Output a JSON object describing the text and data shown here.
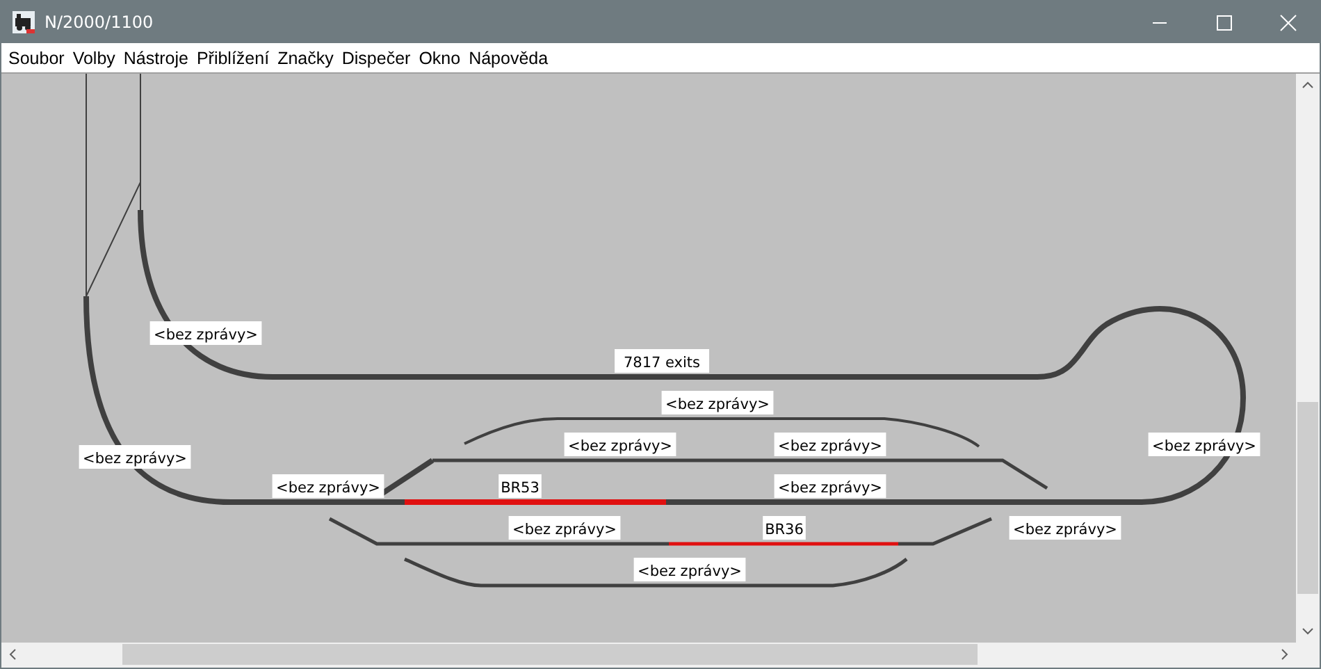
{
  "window": {
    "title": "N/2000/1100"
  },
  "menu": [
    "Soubor",
    "Volby",
    "Nástroje",
    "Přiblížení",
    "Značky",
    "Dispečer",
    "Okno",
    "Nápověda"
  ],
  "blocks": [
    {
      "label": "<bez zprávy>",
      "occupied": false
    },
    {
      "label": "7817 exits",
      "occupied": false
    },
    {
      "label": "<bez zprávy>",
      "occupied": false
    },
    {
      "label": "<bez zprávy>",
      "occupied": false
    },
    {
      "label": "<bez zprávy>",
      "occupied": false
    },
    {
      "label": "<bez zprávy>",
      "occupied": false
    },
    {
      "label": "<bez zprávy>",
      "occupied": false
    },
    {
      "label": "<bez zprávy>",
      "occupied": false
    },
    {
      "label": "BR53",
      "occupied": true
    },
    {
      "label": "<bez zprávy>",
      "occupied": false
    },
    {
      "label": "<bez zprávy>",
      "occupied": false
    },
    {
      "label": "BR36",
      "occupied": true
    },
    {
      "label": "<bez zprávy>",
      "occupied": false
    },
    {
      "label": "<bez zprávy>",
      "occupied": false
    }
  ]
}
